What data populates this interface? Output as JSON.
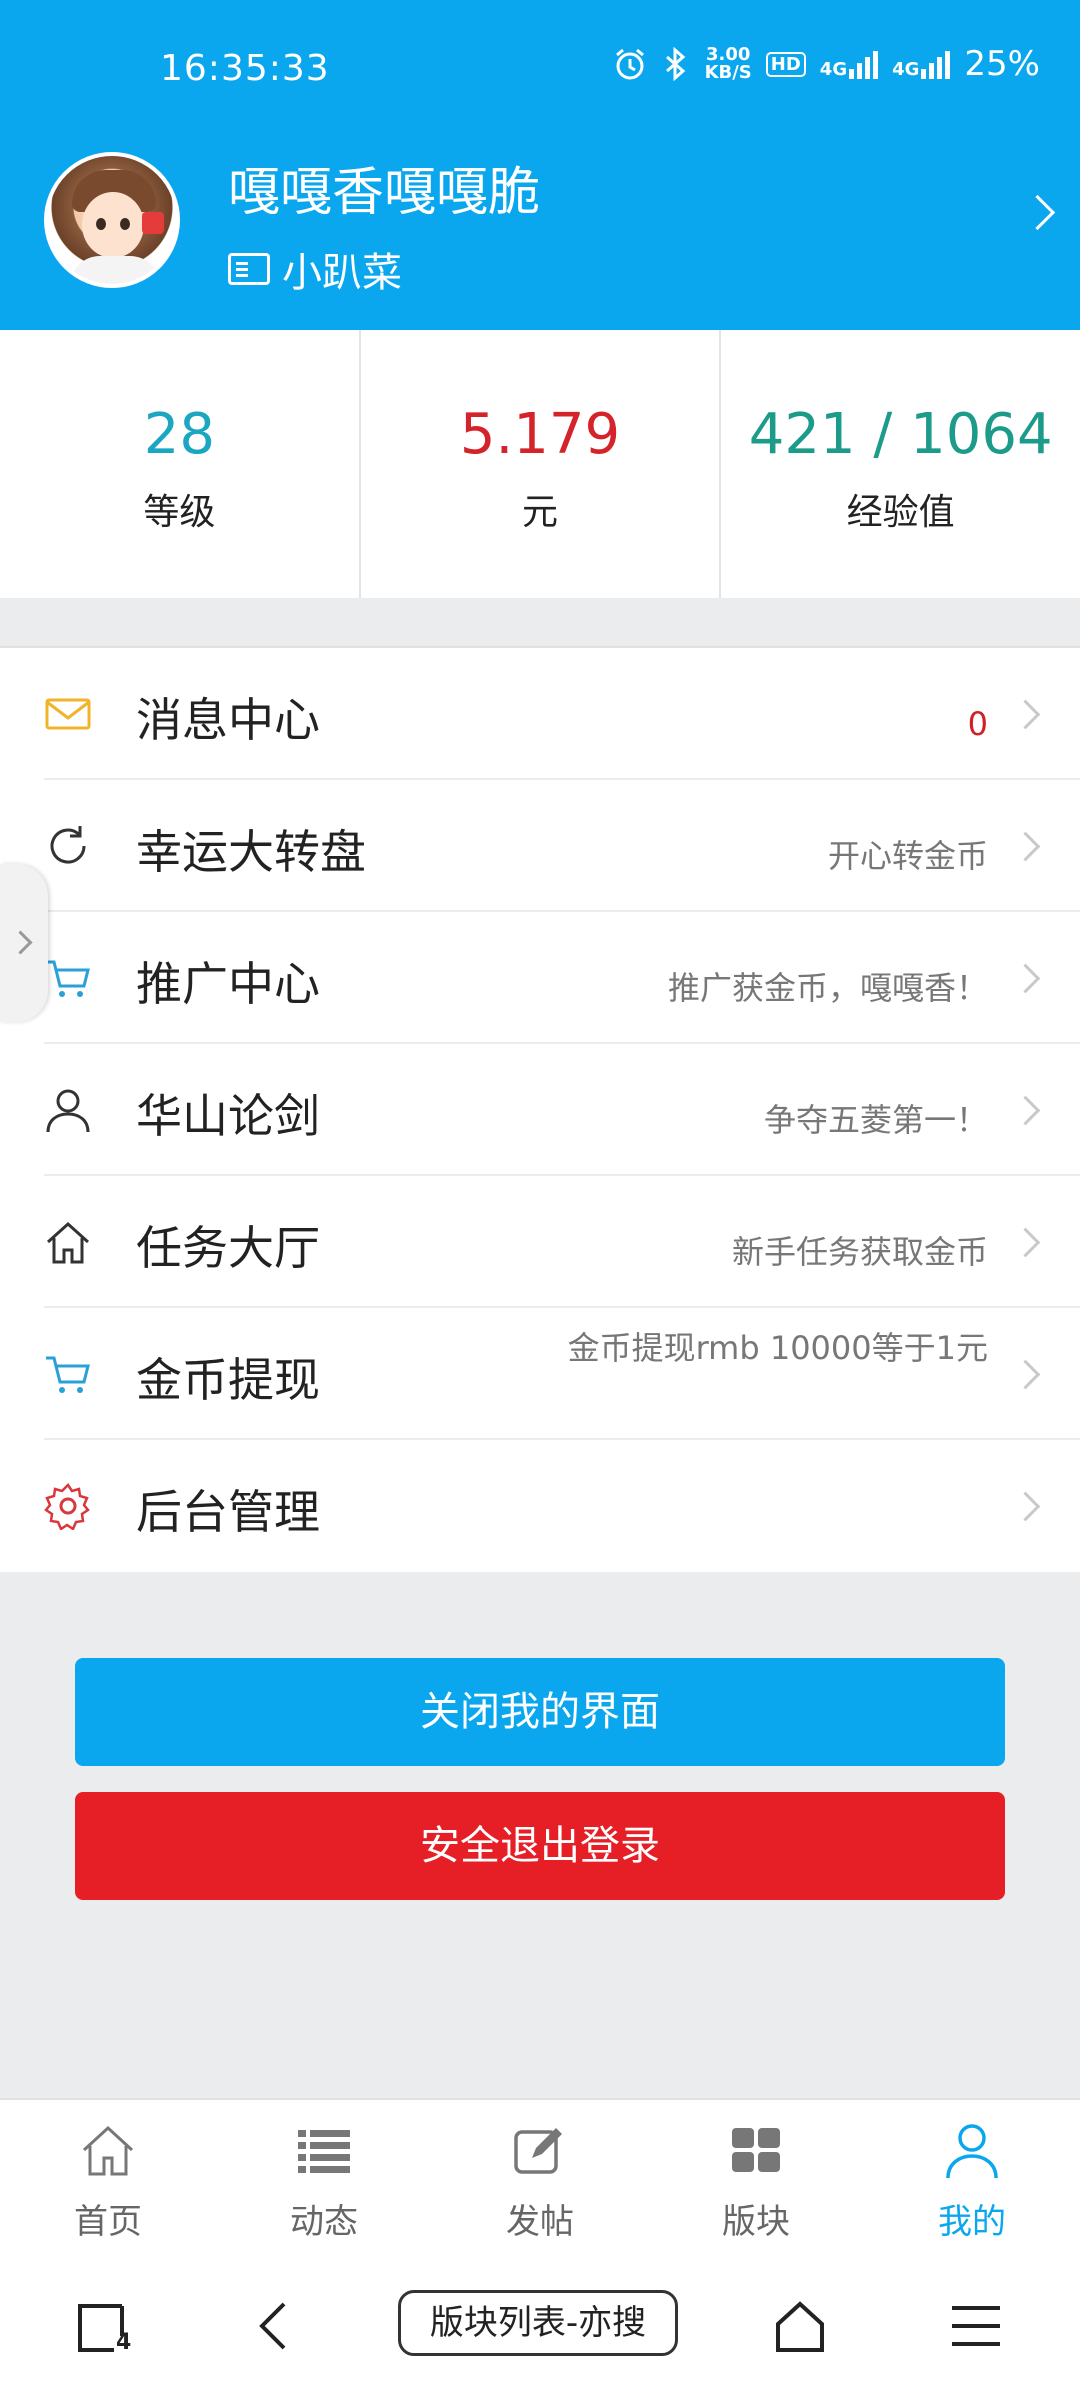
{
  "status_bar": {
    "time": "16:35:33",
    "net_speed_value": "3.00",
    "net_speed_unit": "KB/S",
    "hd_label": "HD",
    "signal1_label": "4G",
    "signal2_label": "4G",
    "battery": "25%"
  },
  "profile": {
    "username": "嘎嘎香嘎嘎脆",
    "group": "小趴菜"
  },
  "stats": [
    {
      "value": "28",
      "label": "等级",
      "color": "#1ba7c2"
    },
    {
      "value": "5.179",
      "label": "元",
      "color": "#d4232a"
    },
    {
      "value": "421 / 1064",
      "label": "经验值",
      "color": "#1c9a8a"
    }
  ],
  "menu": {
    "items": [
      {
        "label": "消息中心",
        "desc": "0",
        "icon": "envelope-icon"
      },
      {
        "label": "幸运大转盘",
        "desc": "开心转金币",
        "icon": "refresh-icon"
      },
      {
        "label": "推广中心",
        "desc": "推广获金币，嘎嘎香！",
        "icon": "cart-icon"
      },
      {
        "label": "华山论剑",
        "desc": "争夺五菱第一！",
        "icon": "user-icon"
      },
      {
        "label": "任务大厅",
        "desc": "新手任务获取金币",
        "icon": "home-icon"
      },
      {
        "label": "金币提现",
        "desc": "金币提现rmb 10000等于1元",
        "icon": "cart-icon"
      },
      {
        "label": "后台管理",
        "desc": "",
        "icon": "gear-icon"
      }
    ]
  },
  "buttons": {
    "close_label": "关闭我的界面",
    "logout_label": "安全退出登录"
  },
  "tabs": [
    {
      "label": "首页",
      "icon": "home-icon"
    },
    {
      "label": "动态",
      "icon": "list-icon"
    },
    {
      "label": "发帖",
      "icon": "edit-icon"
    },
    {
      "label": "版块",
      "icon": "grid-icon"
    },
    {
      "label": "我的",
      "icon": "user-icon",
      "active": true
    }
  ],
  "navbar": {
    "tab_count": "4",
    "search_label": "版块列表-亦搜"
  },
  "colors": {
    "primary": "#0aa7ef",
    "danger": "#e61e26"
  }
}
